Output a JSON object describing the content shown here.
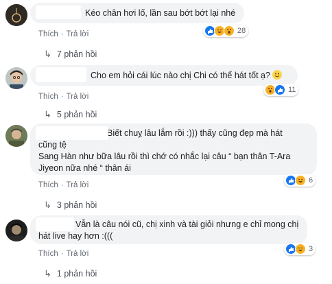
{
  "actions": {
    "like": "Thích",
    "reply": "Trả lời",
    "separator": "·"
  },
  "comments": [
    {
      "text": "Kéo chân hơi lố, lần sau bớt bớt lại nhé",
      "reaction_count": "28",
      "reactions": [
        "like-icon",
        "haha-icon",
        "wow-icon"
      ],
      "replies": "7 phản hồi"
    },
    {
      "text": "Cho em hỏi cái lúc nào chị Chi có thể hát tốt ạ?",
      "emoji": "smiley-icon",
      "reaction_count": "11",
      "reactions": [
        "wow-icon",
        "like-icon"
      ],
      "replies": "5 phản hồi"
    },
    {
      "line1": "Biết chuỵ lâu lắm rồi :))) thấy cũng đẹp mà hát",
      "line2": "cũng tệ",
      "line3": "Sang Hàn như bữa lâu rồi thì chớ có nhắc lại câu “ bạn thân T-Ara",
      "line4": "Jiyeon nữa nhé “ thân ái",
      "reaction_count": "6",
      "reactions": [
        "like-icon",
        "haha-icon"
      ],
      "replies": "3 phản hồi"
    },
    {
      "line1": "Vẫn là câu nói cũ, chị xinh và tài giỏi nhưng e chỉ mong chị",
      "line2": "hát live hay hơn :(((",
      "reaction_count": "3",
      "reactions": [
        "like-icon",
        "haha-icon"
      ],
      "replies": "1 phản hồi"
    }
  ],
  "colors": {
    "like": "#1877f2",
    "haha": "#f7b125",
    "bubble": "#f2f3f5",
    "link": "#606770"
  }
}
